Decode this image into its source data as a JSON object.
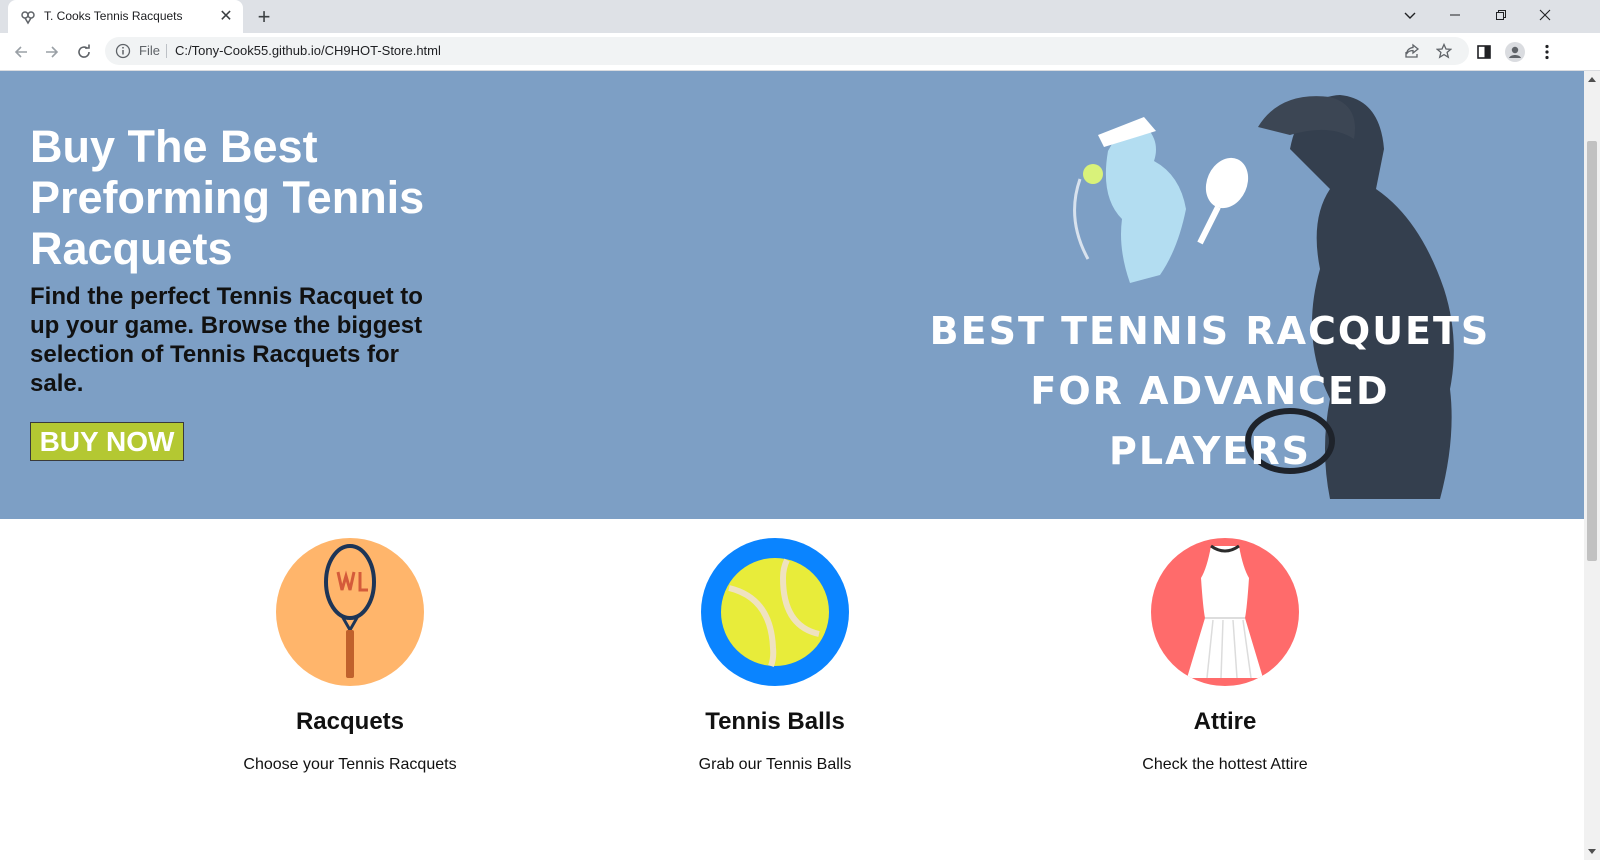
{
  "browser": {
    "tab_title": "T. Cooks Tennis Racquets",
    "tab_close": "✕",
    "new_tab": "+",
    "scheme_label": "File",
    "url": "C:/Tony-Cook55.github.io/CH9HOT-Store.html",
    "icons": [
      "favicon-icon",
      "back-icon",
      "forward-icon",
      "reload-icon",
      "info-icon",
      "share-icon",
      "bookmark-star-icon",
      "side-panel-icon",
      "profile-icon",
      "menu-icon",
      "tab-search-icon",
      "minimize-icon",
      "restore-icon",
      "window-close-icon"
    ]
  },
  "hero": {
    "title": "Buy The Best Preforming Tennis Racquets",
    "subtitle": "Find the perfect Tennis Racquet to up your game. Browse the biggest selection of Tennis Racquets for sale.",
    "button_label": "BUY NOW",
    "banner_lines": [
      "BEST TENNIS RACQUETS",
      "FOR ADVANCED",
      "PLAYERS"
    ],
    "colors": {
      "background": "#7d9fc5",
      "button": "#b4c832"
    }
  },
  "categories": [
    {
      "title": "Racquets",
      "description": "Choose your Tennis Racquets",
      "circle_color": "#ffb56b",
      "icon": "racquet-image"
    },
    {
      "title": "Tennis Balls",
      "description": "Grab our Tennis Balls",
      "circle_color": "#0a84ff",
      "icon": "tennis-ball-image"
    },
    {
      "title": "Attire",
      "description": "Check the hottest Attire",
      "circle_color": "#ff6b6b",
      "icon": "tennis-dress-image"
    }
  ]
}
